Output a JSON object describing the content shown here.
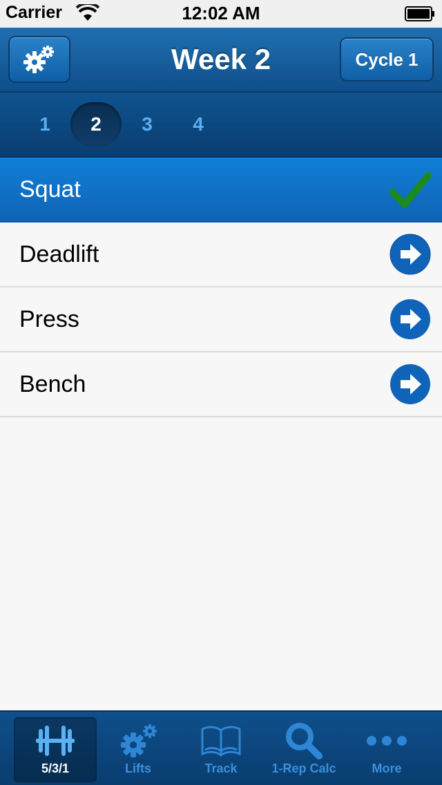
{
  "status_bar": {
    "carrier": "Carrier",
    "time": "12:02 AM"
  },
  "nav": {
    "title": "Week 2",
    "cycle_label": "Cycle 1",
    "settings_icon": "gears-icon"
  },
  "weeks": {
    "items": [
      "1",
      "2",
      "3",
      "4"
    ],
    "selected": "2"
  },
  "lifts": [
    {
      "name": "Squat",
      "status": "complete",
      "icon": "checkmark-icon"
    },
    {
      "name": "Deadlift",
      "status": "pending",
      "icon": "arrow-right-circle-icon"
    },
    {
      "name": "Press",
      "status": "pending",
      "icon": "arrow-right-circle-icon"
    },
    {
      "name": "Bench",
      "status": "pending",
      "icon": "arrow-right-circle-icon"
    }
  ],
  "tabs": [
    {
      "label": "5/3/1",
      "icon": "barbell-icon",
      "active": true
    },
    {
      "label": "Lifts",
      "icon": "gears-icon",
      "active": false
    },
    {
      "label": "Track",
      "icon": "book-icon",
      "active": false
    },
    {
      "label": "1-Rep Calc",
      "icon": "magnifier-icon",
      "active": false
    },
    {
      "label": "More",
      "icon": "ellipsis-icon",
      "active": false
    }
  ],
  "colors": {
    "nav_blue": "#1f6fb0",
    "selected_row": "#1180d8",
    "check_green": "#1c8a1c",
    "tab_inactive": "#3b8fdb"
  }
}
